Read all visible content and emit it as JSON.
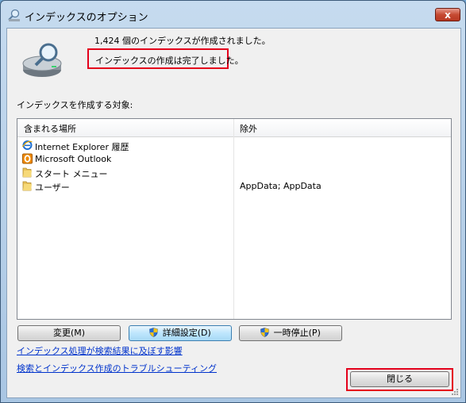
{
  "window": {
    "title": "インデックスのオプション",
    "close_glyph": "x"
  },
  "summary": {
    "count_text": "1,424 個のインデックスが作成されました。",
    "status_text": "インデックスの作成は完了しました。"
  },
  "section_label": "インデックスを作成する対象:",
  "list": {
    "columns": [
      "含まれる場所",
      "除外"
    ],
    "rows": [
      {
        "name": "Internet Explorer 履歴",
        "exclude": "",
        "icon": "internet-explorer-icon"
      },
      {
        "name": "Microsoft Outlook",
        "exclude": "",
        "icon": "outlook-icon"
      },
      {
        "name": "スタート メニュー",
        "exclude": "",
        "icon": "folder-icon"
      },
      {
        "name": "ユーザー",
        "exclude": "AppData; AppData",
        "icon": "folder-icon"
      }
    ]
  },
  "buttons": {
    "modify": "変更(M)",
    "advanced": "詳細設定(D)",
    "pause": "一時停止(P)",
    "close": "閉じる"
  },
  "links": {
    "impact": "インデックス処理が検索結果に及ぼす影響",
    "troubleshoot": "検索とインデックス作成のトラブルシューティング"
  },
  "colors": {
    "highlight_red": "#e4001b",
    "link_blue": "#0033cc"
  }
}
